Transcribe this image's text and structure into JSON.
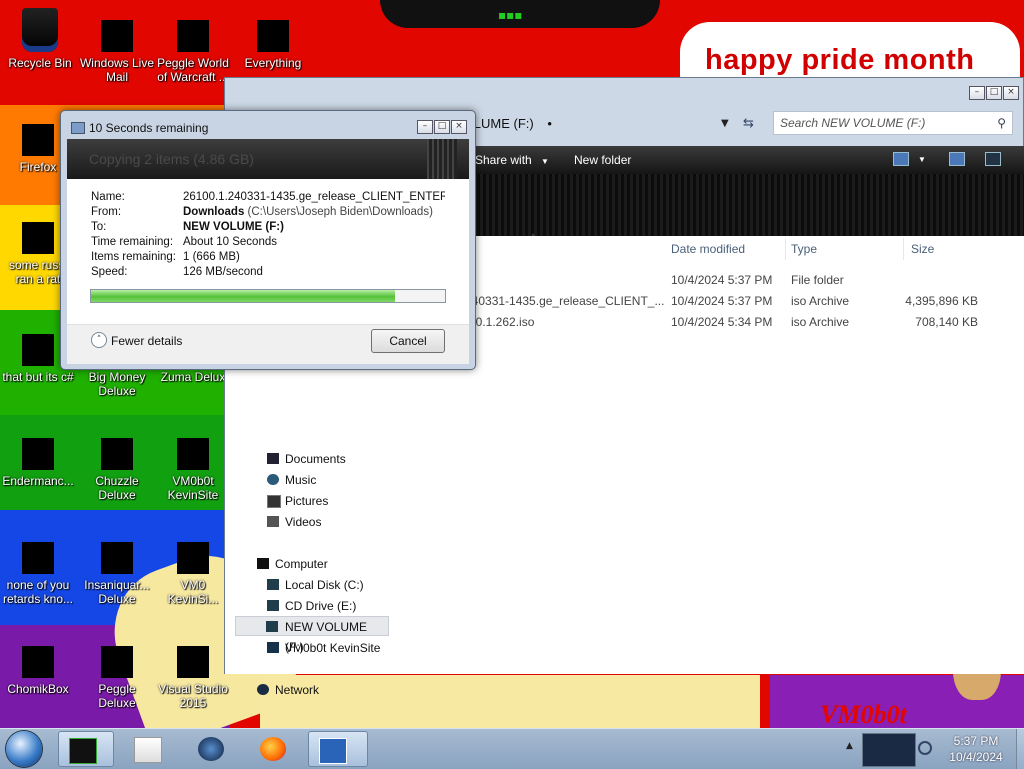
{
  "desktop": {
    "wallpaper_text": "happy pride month",
    "wallpaper_logo": "VM0b0t",
    "icons": [
      {
        "label": "Recycle Bin"
      },
      {
        "label": "Windows Live Mail"
      },
      {
        "label": "Peggle World of Warcraft ..."
      },
      {
        "label": "Everything"
      },
      {
        "label": "Firefox"
      },
      {
        "label": "some russi ran a rat"
      },
      {
        "label": "that but its c#"
      },
      {
        "label": "Big Money Deluxe"
      },
      {
        "label": "Zuma Delux"
      },
      {
        "label": "Endermanc..."
      },
      {
        "label": "Chuzzle Deluxe"
      },
      {
        "label": "VM0b0t KevinSite"
      },
      {
        "label": "none of you retards kno..."
      },
      {
        "label": "Insaniquar... Deluxe"
      },
      {
        "label": "VM0 KevinSi..."
      },
      {
        "label": "ChomikBox"
      },
      {
        "label": "Peggle Deluxe"
      },
      {
        "label": "Visual Studio 2015"
      }
    ]
  },
  "explorer": {
    "address": "VOLUME (F:)",
    "search_placeholder": "Search NEW VOLUME (F:)",
    "toolbar": {
      "share_with": "Share with",
      "new_folder": "New folder"
    },
    "columns": {
      "date": "Date modified",
      "type": "Type",
      "size": "Size"
    },
    "files": [
      {
        "name": "",
        "date": "10/4/2024 5:37 PM",
        "type": "File folder",
        "size": ""
      },
      {
        "name": "240331-1435.ge_release_CLIENT_...",
        "date": "10/4/2024 5:37 PM",
        "type": "iso Archive",
        "size": "4,395,896 KB"
      },
      {
        "name": "n-0.1.262.iso",
        "date": "10/4/2024 5:34 PM",
        "type": "iso Archive",
        "size": "708,140 KB"
      }
    ],
    "nav": {
      "libraries": [
        "Documents",
        "Music",
        "Pictures",
        "Videos"
      ],
      "computer": "Computer",
      "drives": [
        "Local Disk (C:)",
        "CD Drive (E:)",
        "NEW VOLUME (F:)",
        "VM0b0t KevinSite"
      ],
      "network": "Network"
    }
  },
  "copy_dialog": {
    "title": "10 Seconds remaining",
    "header": "Copying 2 items (4.86 GB)",
    "labels": {
      "name": "Name:",
      "from": "From:",
      "to": "To:",
      "time": "Time remaining:",
      "items": "Items remaining:",
      "speed": "Speed:"
    },
    "name_value": "26100.1.240331-1435.ge_release_CLIENT_ENTER...",
    "from_bold": "Downloads",
    "from_path": "(C:\\Users\\Joseph Biden\\Downloads)",
    "to_value": "NEW VOLUME (F:)",
    "time_value": "About 10 Seconds",
    "items_value": "1 (666 MB)",
    "speed_value": "126 MB/second",
    "progress": 0.86,
    "fewer_details": "Fewer details",
    "cancel": "Cancel"
  },
  "taskbar": {
    "clock_time": "5:37 PM",
    "clock_date": "10/4/2024"
  },
  "colors": {
    "progress_green": "#56c13a",
    "pride_red": "#d10000"
  }
}
